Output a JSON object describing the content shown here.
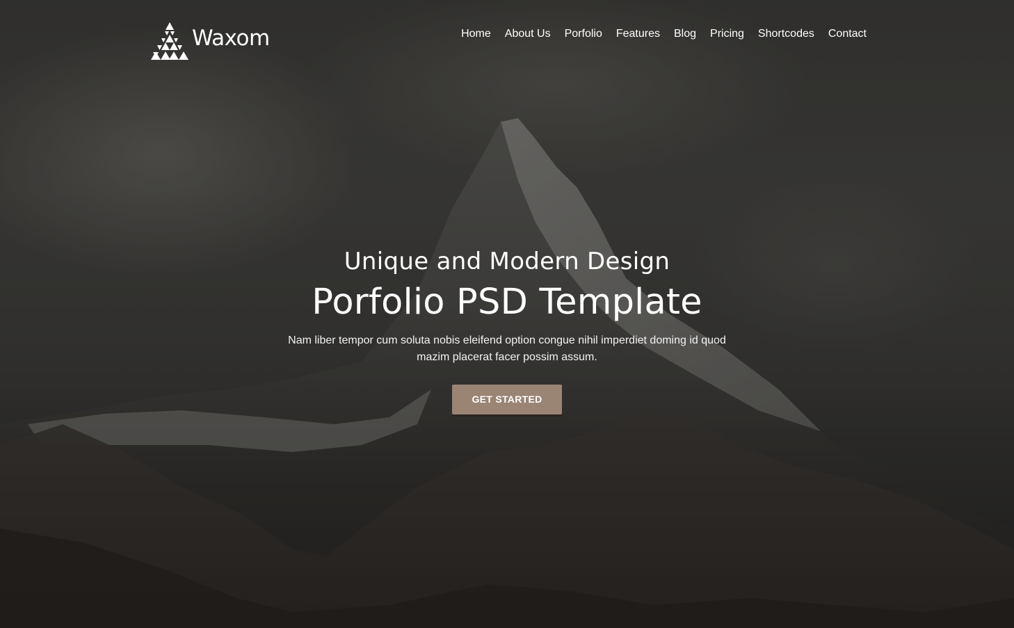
{
  "brand": {
    "name": "Waxom",
    "logo_icon": "triangle-logo-icon"
  },
  "nav": {
    "items": [
      {
        "label": "Home"
      },
      {
        "label": "About Us"
      },
      {
        "label": "Porfolio"
      },
      {
        "label": "Features"
      },
      {
        "label": "Blog"
      },
      {
        "label": "Pricing"
      },
      {
        "label": "Shortcodes"
      },
      {
        "label": "Contact"
      }
    ]
  },
  "hero": {
    "subtitle": "Unique and Modern Design",
    "title": "Porfolio PSD Template",
    "description": "Nam liber tempor cum soluta nobis eleifend option congue nihil imperdiet doming id quod mazim placerat facer possim assum.",
    "cta_label": "GET STARTED"
  },
  "colors": {
    "accent": "#9a8474",
    "text": "#ffffff"
  }
}
